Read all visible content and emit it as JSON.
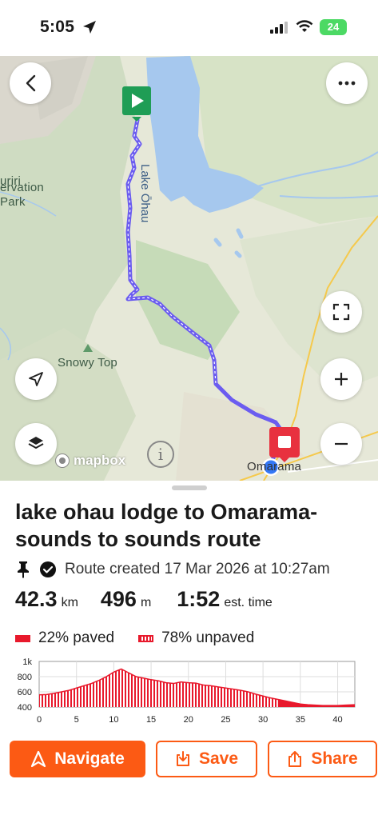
{
  "status_bar": {
    "time": "5:05",
    "battery": "24"
  },
  "map": {
    "labels": {
      "lake": "Lake Ōhau",
      "park_line1": "uriri",
      "park_line2": "ervation",
      "park_line3": "Park",
      "peak": "Snowy Top",
      "town": "Omarama"
    },
    "attribution": "mapbox",
    "info": "i",
    "route_color": "#6b5cf0"
  },
  "route": {
    "title": "lake ohau lodge to Omarama- sounds to sounds route",
    "created": "Route created 17 Mar 2026 at 10:27am",
    "distance_value": "42.3",
    "distance_unit": "km",
    "elevation_value": "496",
    "elevation_unit": "m",
    "time_value": "1:52",
    "time_unit": "est. time",
    "paved_label": "22% paved",
    "unpaved_label": "78% unpaved"
  },
  "chart_data": {
    "type": "area",
    "title": "",
    "xlabel": "",
    "ylabel": "",
    "x_ticks": [
      "0",
      "5",
      "10",
      "15",
      "20",
      "25",
      "30",
      "35",
      "40"
    ],
    "y_ticks": [
      "400",
      "600",
      "800",
      "1k"
    ],
    "xlim": [
      0,
      42.3
    ],
    "ylim": [
      400,
      1000
    ],
    "x": [
      0,
      1,
      2,
      3,
      4,
      5,
      6,
      7,
      8,
      9,
      10,
      11,
      12,
      13,
      14,
      15,
      16,
      17,
      18,
      19,
      20,
      21,
      22,
      23,
      24,
      25,
      26,
      27,
      28,
      29,
      30,
      31,
      32,
      33,
      34,
      35,
      36,
      37,
      38,
      39,
      40,
      41,
      42.3
    ],
    "elevation": [
      560,
      565,
      580,
      600,
      620,
      650,
      680,
      710,
      750,
      800,
      860,
      900,
      850,
      800,
      780,
      760,
      745,
      720,
      710,
      730,
      720,
      715,
      690,
      680,
      665,
      650,
      635,
      620,
      600,
      570,
      545,
      520,
      500,
      480,
      460,
      440,
      430,
      425,
      420,
      420,
      420,
      425,
      430
    ],
    "series": [
      {
        "name": "paved",
        "color": "#e8192c"
      },
      {
        "name": "unpaved",
        "color": "#e8192c",
        "pattern": "striped"
      }
    ]
  },
  "actions": {
    "navigate": "Navigate",
    "save": "Save",
    "share": "Share"
  },
  "colors": {
    "accent": "#fc5a14",
    "paved": "#e8192c",
    "start_marker": "#1f9d55",
    "end_marker": "#e8313f"
  }
}
